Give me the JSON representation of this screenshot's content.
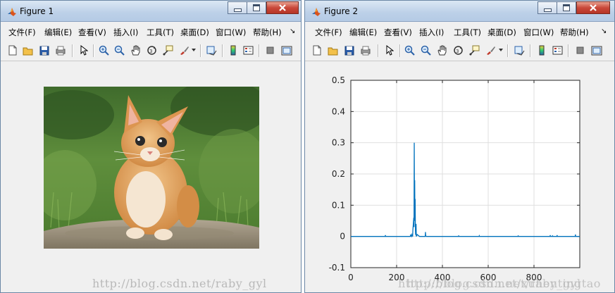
{
  "figure1": {
    "title": "Figure 1",
    "menu": [
      "文件(F)",
      "编辑(E)",
      "查看(V)",
      "插入(I)",
      "工具(T)",
      "桌面(D)",
      "窗口(W)",
      "帮助(H)"
    ],
    "watermark": "http://blog.csdn.net/raby_gyl"
  },
  "figure2": {
    "title": "Figure 2",
    "menu": [
      "文件(F)",
      "编辑(E)",
      "查看(V)",
      "插入(I)",
      "工具(T)",
      "桌面(D)",
      "窗口(W)",
      "帮助(H)"
    ],
    "watermark1": "http://blog.csdn.net/xuhentingtao",
    "watermark2": "http://blog.csdn.net/raby_gyl"
  },
  "colors": {
    "line": "#0072bd",
    "grid": "#dfdfdf",
    "axes_bg": "#ffffff",
    "window_bg": "#f0f0f0"
  },
  "icons": [
    "new-file",
    "open-folder",
    "save",
    "print",
    "pointer",
    "zoom-in",
    "zoom-out",
    "pan-hand",
    "rotate-3d",
    "data-cursor",
    "brush",
    "link-plot",
    "colorbar",
    "legend",
    "hide-plot-tools",
    "show-plot-tools"
  ],
  "chart_data": {
    "type": "line",
    "title": "",
    "xlabel": "",
    "ylabel": "",
    "xlim": [
      0,
      1000
    ],
    "ylim": [
      -0.1,
      0.5
    ],
    "xticks": [
      0,
      200,
      400,
      600,
      800
    ],
    "yticks": [
      -0.1,
      0,
      0.1,
      0.2,
      0.3,
      0.4,
      0.5
    ],
    "grid": true,
    "series": [
      {
        "x": [
          0,
          150,
          151,
          152,
          260,
          261,
          265,
          266,
          270,
          271,
          275,
          276,
          277,
          278,
          279,
          280,
          281,
          282,
          283,
          285,
          286,
          290,
          300,
          325,
          326,
          327,
          330,
          470,
          471,
          472,
          560,
          561,
          562,
          730,
          731,
          732,
          870,
          871,
          872,
          880,
          881,
          882,
          900,
          901,
          902,
          980,
          981,
          982,
          1000
        ],
        "y": [
          0,
          0,
          0.004,
          0,
          0,
          0.004,
          0,
          0.006,
          0,
          0.02,
          0.06,
          0.03,
          0.3,
          0.1,
          0.18,
          0.05,
          0.12,
          0.02,
          0.005,
          0.04,
          0,
          0.006,
          0,
          0,
          0.014,
          0.002,
          0,
          0,
          0.003,
          0,
          0,
          0.002,
          0,
          0,
          0.003,
          0,
          0,
          0.004,
          0,
          0,
          0.003,
          0,
          0,
          0.004,
          0,
          0,
          0.006,
          0,
          0
        ]
      }
    ]
  }
}
